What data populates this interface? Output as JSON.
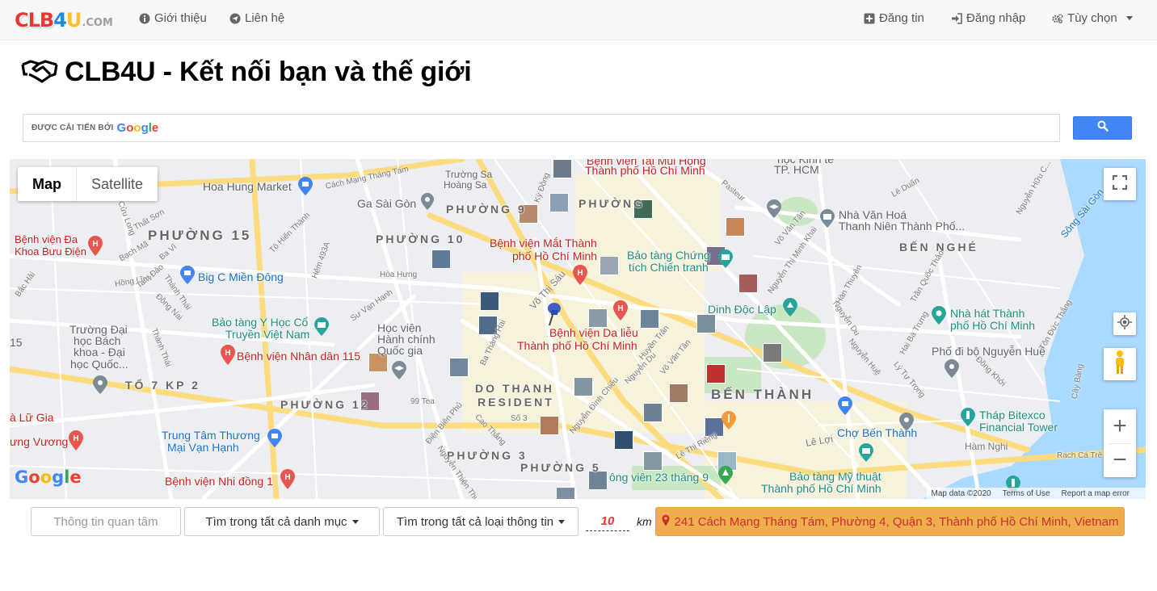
{
  "brand": {
    "part1": "CLB",
    "part2": "4",
    "part3": "U",
    "part4": ".COM"
  },
  "nav": {
    "left": [
      {
        "label": "Giới thiệu",
        "icon": "info-circle-icon"
      },
      {
        "label": "Liên hệ",
        "icon": "paper-plane-icon"
      }
    ],
    "right": [
      {
        "label": "Đăng tin",
        "icon": "plus-square-icon"
      },
      {
        "label": "Đăng nhập",
        "icon": "sign-in-icon"
      },
      {
        "label": "Tùy chọn",
        "icon": "cogs-icon"
      }
    ]
  },
  "header": {
    "title": "CLB4U - Kết nối bạn và thế giới",
    "icon": "handshake-icon"
  },
  "search": {
    "powered_by": "ĐƯỢC CẢI TIẾN BỞI",
    "google": "Google",
    "placeholder": ""
  },
  "map": {
    "type_map": "Map",
    "type_satellite": "Satellite",
    "google_logo": "Google",
    "attribution": {
      "data": "Map data ©2020",
      "terms": "Terms of Use",
      "report": "Report a map error"
    },
    "labels": {
      "hoa_hung_market": "Hoa Hung Market",
      "ga_sai_gon": "Ga Sài Gòn",
      "phuong_15": "PHƯỜNG 15",
      "phuong_10": "PHƯỜNG 10",
      "phuong_9": "PHƯỜNG 9",
      "phuong_top": "PHƯỜNG",
      "phuong_12": "PHƯỜNG 12",
      "phuong_3": "PHƯỜNG 3",
      "phuong_5": "PHƯỜNG 5",
      "to_7_kp_2": "TỔ 7 KP 2",
      "ben_nghe": "BẾN NGHÉ",
      "ben_thanh": "BẾN THÀNH",
      "do_thanh_1": "DO THANH",
      "do_thanh_2": "RESIDENT",
      "bv_mat_1": "Bệnh viện Mắt Thành",
      "bv_mat_2": "phố Hồ Chí Minh",
      "bv_da_lieu_1": "Bệnh viện Da liễu",
      "bv_da_lieu_2": "Thành phố Hồ Chí Minh",
      "bv_nhan_dan": "Bệnh viện Nhân dân 115",
      "bv_buu_dien_1": "Bệnh viện Đa",
      "bv_buu_dien_2": "Khoa Bưu Điện",
      "bv_nhi_dong": "Bệnh viện Nhi đồng 1",
      "bv_tmh_1": "Bệnh viện Tai Mũi Họng",
      "bv_tmh_2": "Thành phố Hồ Chí Minh",
      "big_c": "Big C Miền Đông",
      "bt_yhoc_1": "Bảo tàng Y Học Cổ",
      "bt_yhoc_2": "Truyền Việt Nam",
      "hv_hanh_chinh_1": "Học viện",
      "hv_hanh_chinh_2": "Hành chính",
      "hv_hanh_chinh_3": "Quốc gia",
      "dh_bach_khoa_1": "Trường Đại",
      "dh_bach_khoa_2": "học Bách",
      "dh_bach_khoa_3": "khoa - Đại",
      "dh_bach_khoa_4": "học Quốc...",
      "tt_van_hanh_1": "Trung Tâm Thương",
      "tt_van_hanh_2": "Mại Vạn Hạnh",
      "bt_chien_tranh_1": "Bảo tàng Chứng",
      "bt_chien_tranh_2": "tích Chiến tranh",
      "dinh_doc_lap": "Dinh Độc Lập",
      "nha_van_hoa_1": "Nhà Văn Hoá",
      "nha_van_hoa_2": "Thanh Niên Thành Phố...",
      "nha_hat_1": "Nhà hát Thành",
      "nha_hat_2": "phố Hồ Chí Minh",
      "pho_di_bo": "Phố đi bộ Nguyễn Huệ",
      "bitexco_1": "Tháp Bitexco",
      "bitexco_2": "Financial Tower",
      "cho_ben_thanh": "Chợ Bến Thành",
      "bt_my_thuat_1": "Bảo tàng Mỹ thuật",
      "bt_my_thuat_2": "Thành phố Hồ Chí Minh",
      "cong_vien": "ông viên 23 tháng 9",
      "hoc_kinh_te_1": "học Kinh tế",
      "hoc_kinh_te_2": "TP. HCM",
      "truong_sa": "Trường Sa",
      "hoang_sa": "Hoàng Sa",
      "lu_gia": "à Lữ Gia",
      "hung_vuong": "ưng Vương",
      "num_15": "15",
      "song_sai_gon": "Sông Sài Gòn",
      "tea_99": "99 Tea",
      "ham_nghi": "Hàm Nghi",
      "le_loi": "Lê Lợi",
      "bac_hai": "Bắc Hải",
      "to_hien_thanh": "Tô Hiến Thành",
      "vo_thi_sau": "Võ Thị Sáu",
      "thanh_thai": "Thành Thái",
      "nguyen_du": "Nguyễn Du",
      "le_duan": "Lê Duẩn",
      "dien_bien_phu": "Điện Biên Phủ",
      "nguyen_dinh_chieu": "Nguyễn Đình Chiểu",
      "ba_thang_hai": "Ba Tháng Hai",
      "cach_mang_thang_tam": "Cách Mạng Tháng Tám",
      "nguyen_thien_thuat": "Nguyễn Thiện Thuật",
      "pasteur": "Pasteur",
      "le_thi_rieng": "Lê Thị Riêng",
      "vo_van_tan": "Võ Văn Tần",
      "hai_ba_trung": "Hai Bà Trưng",
      "dong_khoi": "Đồng Khởi",
      "nguyen_hue": "Nguyễn Huệ",
      "ton_duc_thang": "Tôn Đức Thắng",
      "rach_ca_tre": "Rạch Cá Trê",
      "cay_bang": "Cây Bàng",
      "tran_quoc_thao": "Trần Quốc Thảo",
      "ky_dong": "Kỳ Đồng",
      "hoa_hung": "Hòa Hưng",
      "su_van_hanh": "Sư Vạn Hạnh",
      "bach_ma": "Bạch Mã",
      "ba_vi": "Ba Vì",
      "that_son": "Thất Sơn",
      "cuu_long": "Cửu Long",
      "thanh_thai_2": "Thành Thái",
      "hem_493a": "Hẻm 493A",
      "hong_linh": "Hồng Lĩnh",
      "tam_dao": "Tam Đảo",
      "dong_nai": "Đồng Nai",
      "cao_thang": "Cao Thắng",
      "so_3": "Số 3",
      "nguyen_du_2": "Nguyễn Du",
      "huyen_tran": "Huyền Trân",
      "han_thuyen": "Hàn Thuyên",
      "nguyen_thi_minh_khai": "Nguyễn Thị Minh Khai",
      "ly_tu_trong": "Lý Tự Trọng",
      "nguyen_huu_canh": "Nguyễn Hữu C..."
    }
  },
  "filters": {
    "interest_placeholder": "Thông tin quan tâm",
    "category": "Tìm trong tất cả danh mục",
    "info_type": "Tìm trong tất cả loại thông tin",
    "distance": "10",
    "unit": "km",
    "location": "241 Cách Mạng Tháng Tám, Phường 4, Quận 3, Thành phố Hồ Chí Minh, Vietnam"
  },
  "colors": {
    "accent_blue": "#4285f4",
    "location_button": "#f0ad4e",
    "location_text": "#c9302c",
    "distance_text": "#e53935"
  }
}
